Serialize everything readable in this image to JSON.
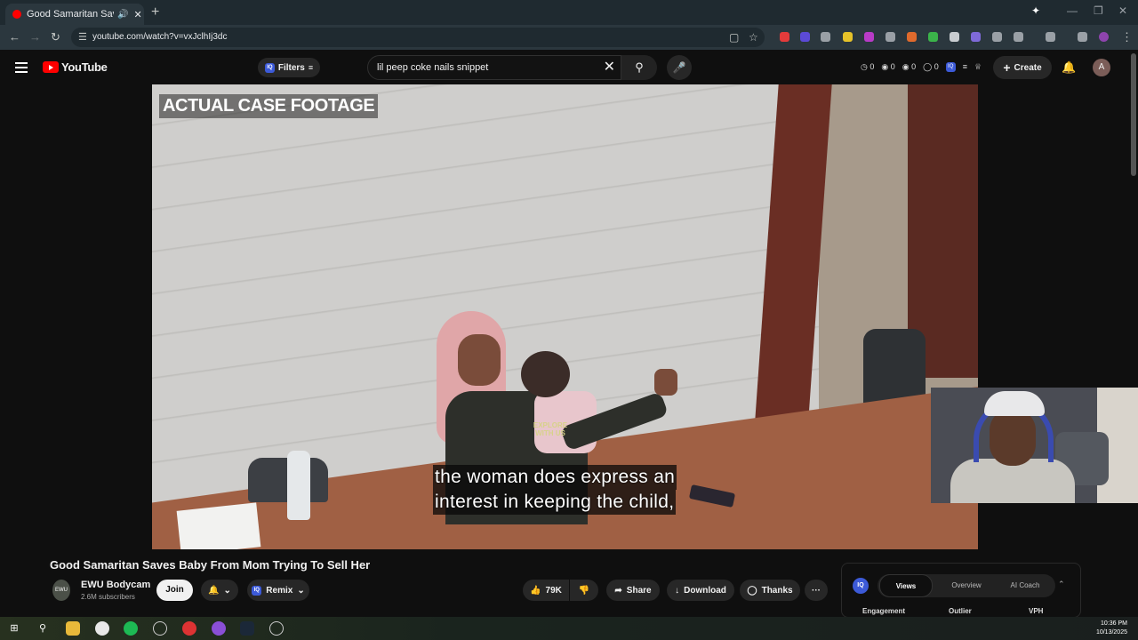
{
  "browser": {
    "tab_title": "Good Samaritan Saves Baby",
    "tab_sound_icon": "speaker-icon",
    "new_tab": "+",
    "url": "youtube.com/watch?v=vxJclhIj3dc"
  },
  "youtube": {
    "logo_text": "YouTube",
    "filters_label": "Filters",
    "search_value": "lil peep coke nails snippet",
    "stats": [
      "0",
      "0",
      "0",
      "0"
    ],
    "create_label": "Create",
    "avatar_letter": "A"
  },
  "video": {
    "overlay_text": "ACTUAL CASE FOOTAGE",
    "caption_line1": "the woman does express an",
    "caption_line2": "interest in keeping the child,",
    "shirt_text1": "EXPLORE",
    "shirt_text2": "WITH US"
  },
  "info": {
    "title": "Good Samaritan Saves Baby From Mom Trying To Sell Her",
    "channel_name": "EWU Bodycam",
    "subscribers": "2.6M subscribers",
    "join_label": "Join",
    "remix_label": "Remix",
    "likes": "79K",
    "share_label": "Share",
    "download_label": "Download",
    "thanks_label": "Thanks",
    "more_label": "···"
  },
  "panel": {
    "iq_label": "IQ",
    "tabs": [
      "Views",
      "Overview",
      "AI Coach"
    ],
    "active_tab": "Views",
    "columns": [
      "Engagement",
      "Outlier",
      "VPH"
    ]
  },
  "taskbar": {
    "time": "10:36 PM",
    "date": "10/13/2025"
  },
  "colors": {
    "yt_red": "#ff0000",
    "bg": "#0f0f0f",
    "chrome_bar": "#2b373e",
    "iq_blue": "#3c5ad8"
  }
}
